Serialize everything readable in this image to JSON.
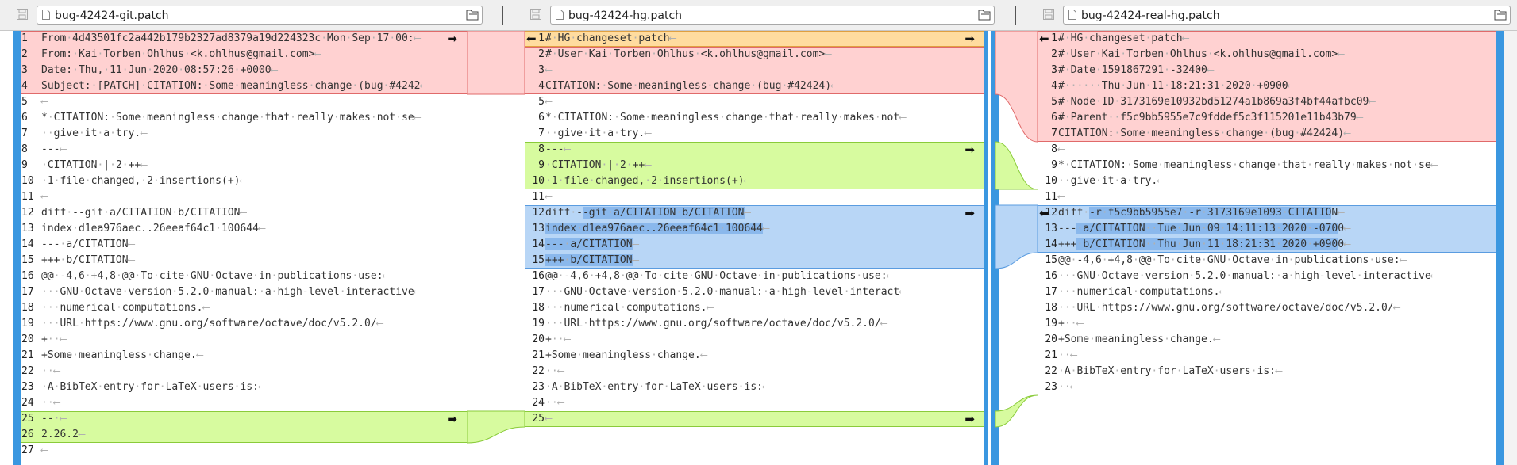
{
  "colors": {
    "delete": "#ffd1d1",
    "delete_border": "#e06a6a",
    "insert": "#d7fb9f",
    "insert_border": "#8acb3a",
    "replace": "#b8d6f6",
    "replace_border": "#5a9ce0",
    "conflict": "#ffdc9f",
    "conflict_border": "#e0a040",
    "highlight": "#8ab8ec"
  },
  "icons": {
    "save": "save-icon",
    "file": "file-icon",
    "open": "folder-open-icon",
    "arrow_right": "arrow-right-icon",
    "arrow_left": "arrow-left-icon"
  },
  "panes": [
    {
      "filename": "bug-42424-git.patch",
      "lines": [
        {
          "n": "1",
          "t": "From 4d43501fc2a442b179b2327ad8379a19d224323c Mon Sep 17 00:"
        },
        {
          "n": "2",
          "t": "From: Kai Torben Ohlhus <k.ohlhus@gmail.com>"
        },
        {
          "n": "3",
          "t": "Date: Thu, 11 Jun 2020 08:57:26 +0000"
        },
        {
          "n": "4",
          "t": "Subject: [PATCH] CITATION: Some meaningless change (bug #4242"
        },
        {
          "n": "5",
          "t": ""
        },
        {
          "n": "6",
          "t": "* CITATION: Some meaningless change that really makes not se"
        },
        {
          "n": "7",
          "t": "  give it a try."
        },
        {
          "n": "8",
          "t": "---"
        },
        {
          "n": "9",
          "t": " CITATION | 2 ++"
        },
        {
          "n": "10",
          "t": " 1 file changed, 2 insertions(+)"
        },
        {
          "n": "11",
          "t": ""
        },
        {
          "n": "12",
          "t": "diff --git a/CITATION b/CITATION"
        },
        {
          "n": "13",
          "t": "index d1ea976aec..26eeaf64c1 100644"
        },
        {
          "n": "14",
          "t": "--- a/CITATION"
        },
        {
          "n": "15",
          "t": "+++ b/CITATION"
        },
        {
          "n": "16",
          "t": "@@ -4,6 +4,8 @@ To cite GNU Octave in publications use:"
        },
        {
          "n": "17",
          "t": "   GNU Octave version 5.2.0 manual: a high-level interactive"
        },
        {
          "n": "18",
          "t": "   numerical computations."
        },
        {
          "n": "19",
          "t": "   URL https://www.gnu.org/software/octave/doc/v5.2.0/"
        },
        {
          "n": "20",
          "t": "+  "
        },
        {
          "n": "21",
          "t": "+Some meaningless change."
        },
        {
          "n": "22",
          "t": "  "
        },
        {
          "n": "23",
          "t": " A BibTeX entry for LaTeX users is:"
        },
        {
          "n": "24",
          "t": "  "
        },
        {
          "n": "25",
          "t": "-- "
        },
        {
          "n": "26",
          "t": "2.26.2"
        },
        {
          "n": "27",
          "t": ""
        }
      ]
    },
    {
      "filename": "bug-42424-hg.patch",
      "lines": [
        {
          "n": "1",
          "t": "# HG changeset patch"
        },
        {
          "n": "2",
          "t": "# User Kai Torben Ohlhus <k.ohlhus@gmail.com>"
        },
        {
          "n": "3",
          "t": ""
        },
        {
          "n": "4",
          "t": "CITATION: Some meaningless change (bug #42424)"
        },
        {
          "n": "5",
          "t": ""
        },
        {
          "n": "6",
          "t": "* CITATION: Some meaningless change that really makes not"
        },
        {
          "n": "7",
          "t": "  give it a try."
        },
        {
          "n": "8",
          "t": "---"
        },
        {
          "n": "9",
          "t": " CITATION | 2 ++"
        },
        {
          "n": "10",
          "t": " 1 file changed, 2 insertions(+)"
        },
        {
          "n": "11",
          "t": ""
        },
        {
          "n": "12",
          "t": "diff --git a/CITATION b/CITATION"
        },
        {
          "n": "13",
          "t": "index d1ea976aec..26eeaf64c1 100644"
        },
        {
          "n": "14",
          "t": "--- a/CITATION"
        },
        {
          "n": "15",
          "t": "+++ b/CITATION"
        },
        {
          "n": "16",
          "t": "@@ -4,6 +4,8 @@ To cite GNU Octave in publications use:"
        },
        {
          "n": "17",
          "t": "   GNU Octave version 5.2.0 manual: a high-level interact"
        },
        {
          "n": "18",
          "t": "   numerical computations."
        },
        {
          "n": "19",
          "t": "   URL https://www.gnu.org/software/octave/doc/v5.2.0/"
        },
        {
          "n": "20",
          "t": "+  "
        },
        {
          "n": "21",
          "t": "+Some meaningless change."
        },
        {
          "n": "22",
          "t": "  "
        },
        {
          "n": "23",
          "t": " A BibTeX entry for LaTeX users is:"
        },
        {
          "n": "24",
          "t": "  "
        },
        {
          "n": "25",
          "t": ""
        }
      ]
    },
    {
      "filename": "bug-42424-real-hg.patch",
      "lines": [
        {
          "n": "1",
          "t": "# HG changeset patch"
        },
        {
          "n": "2",
          "t": "# User Kai Torben Ohlhus <k.ohlhus@gmail.com>"
        },
        {
          "n": "3",
          "t": "# Date 1591867291 -32400"
        },
        {
          "n": "4",
          "t": "#      Thu Jun 11 18:21:31 2020 +0900"
        },
        {
          "n": "5",
          "t": "# Node ID 3173169e10932bd51274a1b869a3f4bf44afbc09"
        },
        {
          "n": "6",
          "t": "# Parent  f5c9bb5955e7c9fddef5c3f115201e11b43b79"
        },
        {
          "n": "7",
          "t": "CITATION: Some meaningless change (bug #42424)"
        },
        {
          "n": "8",
          "t": ""
        },
        {
          "n": "9",
          "t": "* CITATION: Some meaningless change that really makes not se"
        },
        {
          "n": "10",
          "t": "  give it a try."
        },
        {
          "n": "11",
          "t": ""
        },
        {
          "n": "12",
          "t": "diff -r f5c9bb5955e7 -r 3173169e1093 CITATION"
        },
        {
          "n": "13",
          "t": "--- a/CITATION  Tue Jun 09 14:11:13 2020 -0700"
        },
        {
          "n": "14",
          "t": "+++ b/CITATION  Thu Jun 11 18:21:31 2020 +0900"
        },
        {
          "n": "15",
          "t": "@@ -4,6 +4,8 @@ To cite GNU Octave in publications use:"
        },
        {
          "n": "16",
          "t": "   GNU Octave version 5.2.0 manual: a high-level interactive"
        },
        {
          "n": "17",
          "t": "   numerical computations."
        },
        {
          "n": "18",
          "t": "   URL https://www.gnu.org/software/octave/doc/v5.2.0/"
        },
        {
          "n": "19",
          "t": "+  "
        },
        {
          "n": "20",
          "t": "+Some meaningless change."
        },
        {
          "n": "21",
          "t": "  "
        },
        {
          "n": "22",
          "t": " A BibTeX entry for LaTeX users is:"
        },
        {
          "n": "23",
          "t": "  "
        }
      ]
    }
  ]
}
